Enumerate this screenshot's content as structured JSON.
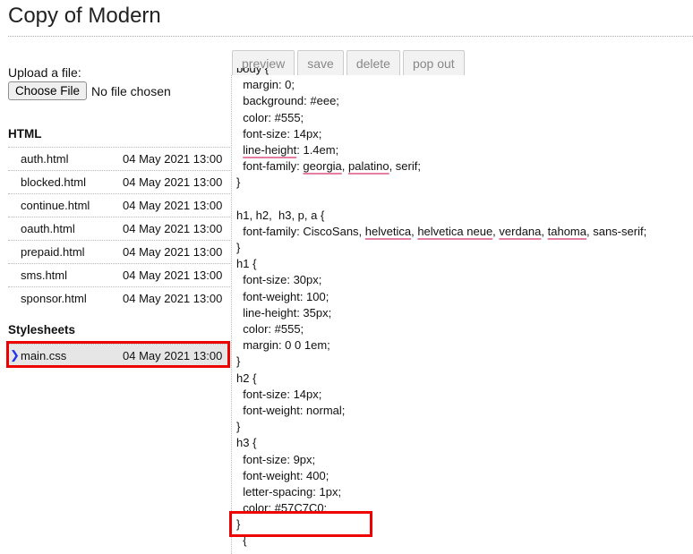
{
  "page": {
    "title": "Copy of Modern"
  },
  "upload": {
    "label": "Upload a file:",
    "button_label": "Choose File",
    "no_file_text": "No file chosen"
  },
  "html_section": {
    "heading": "HTML",
    "files": [
      {
        "name": "auth.html",
        "date": "04 May 2021 13:00"
      },
      {
        "name": "blocked.html",
        "date": "04 May 2021 13:00"
      },
      {
        "name": "continue.html",
        "date": "04 May 2021 13:00"
      },
      {
        "name": "oauth.html",
        "date": "04 May 2021 13:00"
      },
      {
        "name": "prepaid.html",
        "date": "04 May 2021 13:00"
      },
      {
        "name": "sms.html",
        "date": "04 May 2021 13:00"
      },
      {
        "name": "sponsor.html",
        "date": "04 May 2021 13:00"
      }
    ]
  },
  "stylesheets_section": {
    "heading": "Stylesheets",
    "files": [
      {
        "name": "main.css",
        "date": "04 May 2021 13:00",
        "selected": true
      }
    ]
  },
  "toolbar": {
    "preview": "preview",
    "save": "save",
    "delete": "delete",
    "pop_out": "pop out"
  },
  "editor": {
    "lines": [
      [
        {
          "t": "body {"
        }
      ],
      [
        {
          "t": "  margin: 0;"
        }
      ],
      [
        {
          "t": "  background: #eee;"
        }
      ],
      [
        {
          "t": "  color: #555;"
        }
      ],
      [
        {
          "t": "  font-size: 14px;"
        }
      ],
      [
        {
          "t": "  "
        },
        {
          "t": "line-height",
          "sq": true
        },
        {
          "t": ": 1.4em;"
        }
      ],
      [
        {
          "t": "  font-family: "
        },
        {
          "t": "georgia",
          "sq": true
        },
        {
          "t": ", "
        },
        {
          "t": "palatino",
          "sq": true
        },
        {
          "t": ", serif;"
        }
      ],
      [
        {
          "t": "}"
        }
      ],
      [
        {
          "t": ""
        }
      ],
      [
        {
          "t": "h1, h2,  h3, p, a {"
        }
      ],
      [
        {
          "t": "  font-family: CiscoSans, "
        },
        {
          "t": "helvetica",
          "sq": true
        },
        {
          "t": ", "
        },
        {
          "t": "helvetica neue",
          "sq": true
        },
        {
          "t": ", "
        },
        {
          "t": "verdana",
          "sq": true
        },
        {
          "t": ", "
        },
        {
          "t": "tahoma",
          "sq": true
        },
        {
          "t": ", sans-serif;"
        }
      ],
      [
        {
          "t": "}"
        }
      ],
      [
        {
          "t": "h1 {"
        }
      ],
      [
        {
          "t": "  font-size: 30px;"
        }
      ],
      [
        {
          "t": "  font-weight: 100;"
        }
      ],
      [
        {
          "t": "  line-height: 35px;"
        }
      ],
      [
        {
          "t": "  color: #555;"
        }
      ],
      [
        {
          "t": "  margin: 0 0 1em;"
        }
      ],
      [
        {
          "t": "}"
        }
      ],
      [
        {
          "t": "h2 {"
        }
      ],
      [
        {
          "t": "  font-size: 14px;"
        }
      ],
      [
        {
          "t": "  font-weight: normal;"
        }
      ],
      [
        {
          "t": "}"
        }
      ],
      [
        {
          "t": "h3 {"
        }
      ],
      [
        {
          "t": "  font-size: 9px;"
        }
      ],
      [
        {
          "t": "  font-weight: 400;"
        }
      ],
      [
        {
          "t": "  letter-spacing: 1px;"
        }
      ],
      [
        {
          "t": "  color: #57C7C0;"
        }
      ],
      [
        {
          "t": "}"
        }
      ],
      [
        {
          "t": "  {"
        }
      ]
    ]
  },
  "colors": {
    "highlight": "#e00000",
    "selected_row": "#e6e6e6",
    "squiggle": "#e57fa0",
    "selection_marker": "#2233ee"
  }
}
